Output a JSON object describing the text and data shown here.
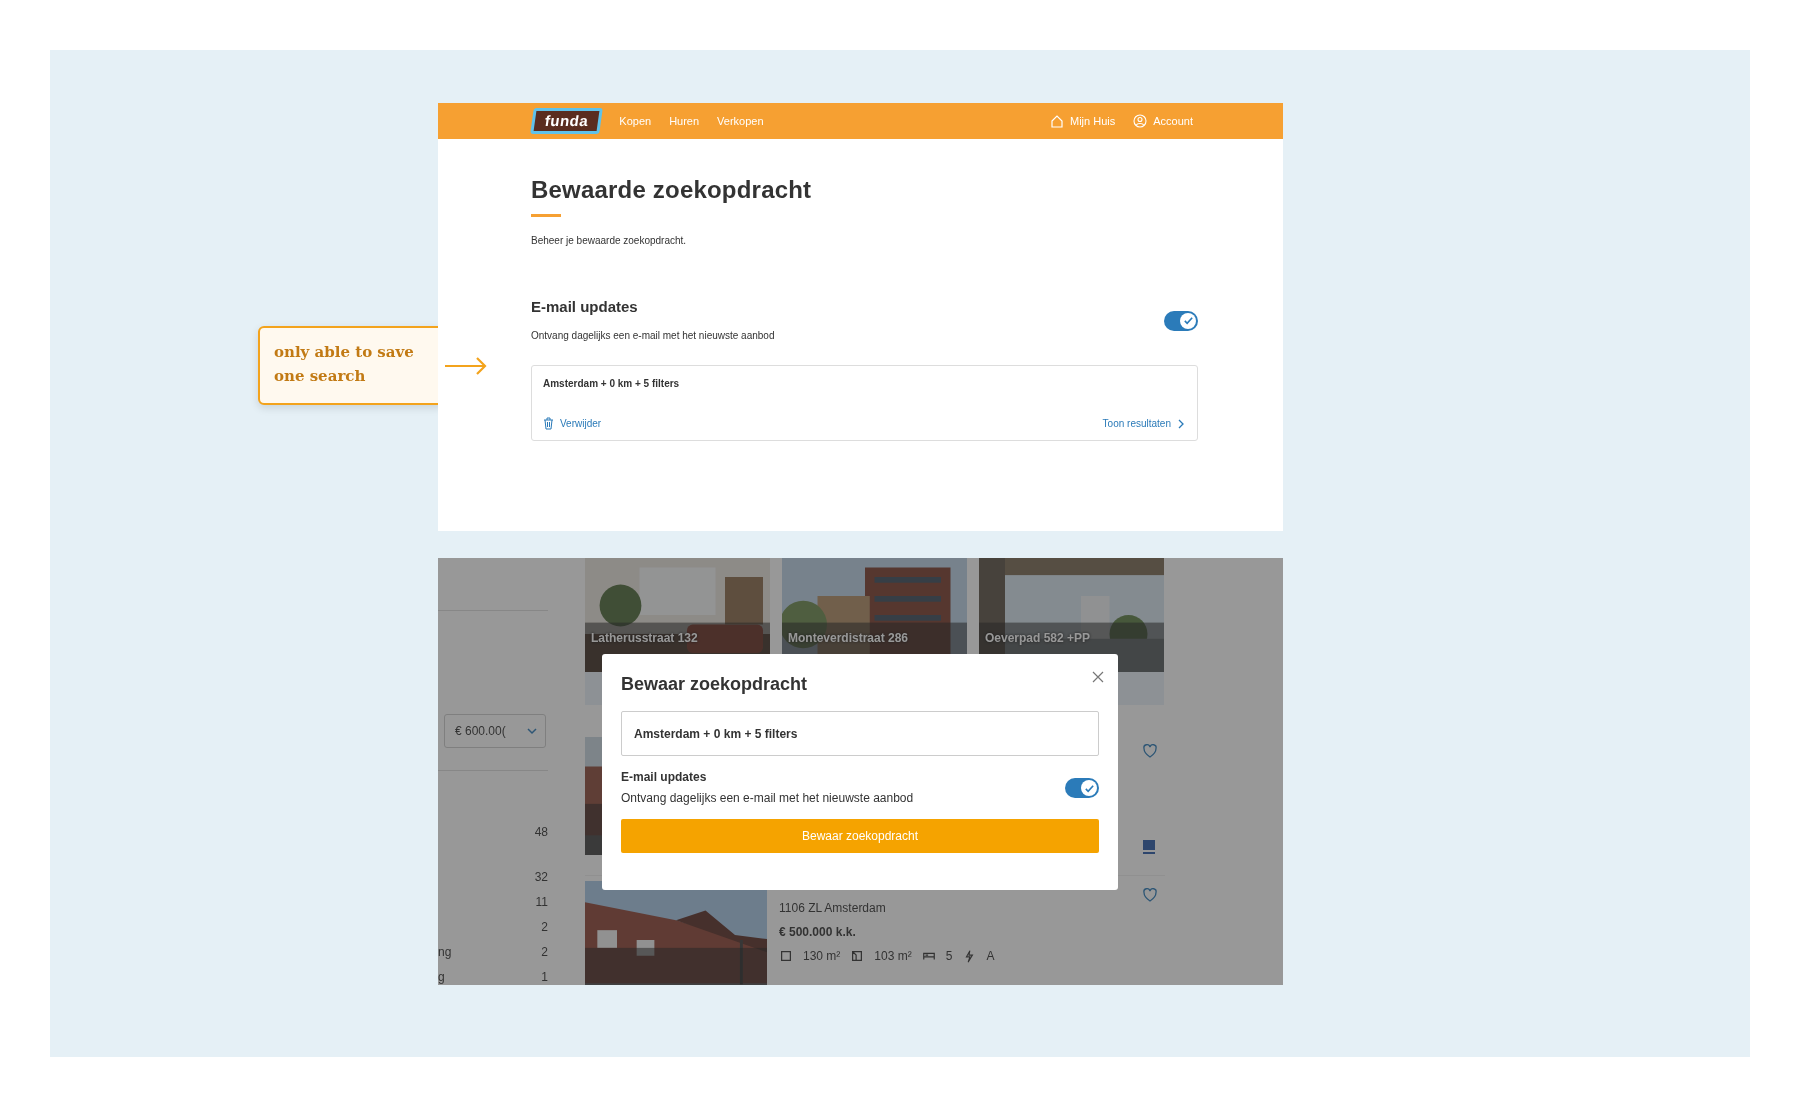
{
  "annotation": {
    "text": "only able to save one search"
  },
  "saved_search_page": {
    "header": {
      "logo": "funda",
      "nav": [
        "Kopen",
        "Huren",
        "Verkopen"
      ],
      "right": [
        {
          "label": "Mijn Huis"
        },
        {
          "label": "Account"
        }
      ]
    },
    "title": "Bewaarde zoekopdracht",
    "subtitle": "Beheer je bewaarde zoekopdracht.",
    "email_updates": {
      "title": "E-mail updates",
      "description": "Ontvang dagelijks een e-mail met het nieuwste aanbod",
      "on": true
    },
    "saved_search": {
      "name": "Amsterdam + 0 km + 5 filters",
      "delete": "Verwijder",
      "show_results": "Toon resultaten"
    }
  },
  "save_dialog_screen": {
    "background": {
      "price_filter": "€ 600.00(",
      "count_groups": [
        [
          {
            "count": "48"
          }
        ],
        [
          {
            "count": "32"
          },
          {
            "count": "11"
          },
          {
            "count": "2"
          },
          {
            "label": "ng",
            "count": "2"
          },
          {
            "label": "g",
            "count": "1"
          }
        ]
      ],
      "featured": [
        {
          "kind": "interior",
          "title": "Latherusstraat 132"
        },
        {
          "kind": "building",
          "title": "Monteverdistraat 286"
        },
        {
          "kind": "balcony",
          "title": "Oeverpad 582 +PP"
        }
      ],
      "listings": [
        {
          "kind": "street"
        },
        {
          "kind": "rowhouses",
          "postcode": "1106 ZL Amsterdam",
          "price": "€ 500.000 k.k.",
          "features": [
            "130 m²",
            "103 m²",
            "5",
            "A"
          ]
        }
      ]
    },
    "dialog": {
      "title": "Bewaar zoekopdracht",
      "field_value": "Amsterdam + 0 km + 5 filters",
      "email_title": "E-mail updates",
      "email_description": "Ontvang dagelijks een e-mail met het nieuwste aanbod",
      "email_on": true,
      "button": "Bewaar zoekopdracht"
    }
  }
}
